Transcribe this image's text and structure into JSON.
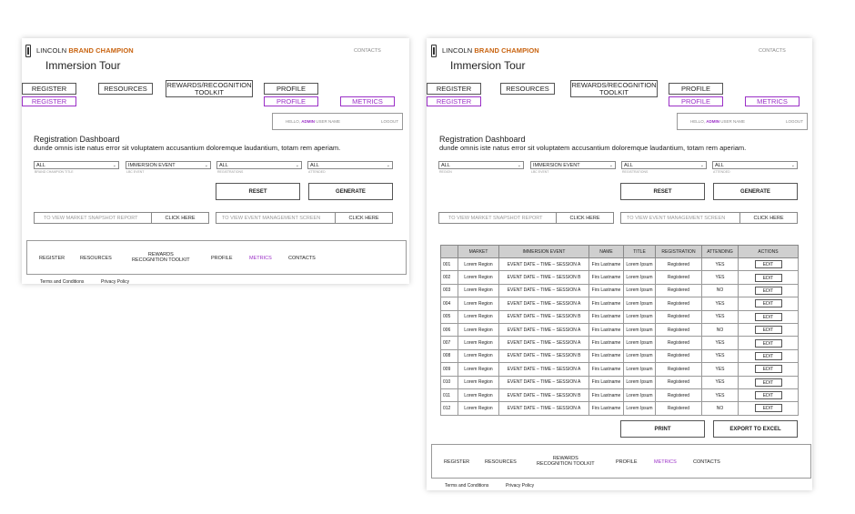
{
  "header": {
    "brand_prefix": "LINCOLN",
    "brand_name": "BRAND CHAMPION",
    "title": "Immersion Tour",
    "contacts_link": "CONTACTS"
  },
  "nav": {
    "register": "REGISTER",
    "resources": "RESOURCES",
    "rewards": "REWARDS/RECOGNITION TOOLKIT",
    "profile": "PROFILE",
    "sub_register": "REGISTER",
    "sub_profile": "PROFILE",
    "sub_metrics": "METRICS"
  },
  "user": {
    "hello": "HELLO,",
    "admin": "ADMIN",
    "user_name": "USER NAME",
    "logout": "LOGOUT"
  },
  "dashboard": {
    "title": "Registration Dashboard",
    "description": "dunde omnis iste natus error sit voluptatem accusantium doloremque laudantium, totam rem aperiam."
  },
  "filters": {
    "left": [
      {
        "value": "ALL",
        "label": "BRAND CHAMPION TITLE"
      },
      {
        "value": "IMMERSION EVENT",
        "label": "LBC EVENT"
      },
      {
        "value": "ALL",
        "label": "REGISTRATIONS"
      },
      {
        "value": "ALL",
        "label": "ATTENDED"
      }
    ],
    "right": [
      {
        "value": "ALL",
        "label": "REGION"
      },
      {
        "value": "IMMERSION EVENT",
        "label": "LBC EVENT"
      },
      {
        "value": "ALL",
        "label": "REGISTRATIONS"
      },
      {
        "value": "ALL",
        "label": "ATTENDED"
      }
    ],
    "chevron": "⌄"
  },
  "actions": {
    "reset": "RESET",
    "generate": "GENERATE",
    "print": "PRINT",
    "export": "EXPORT TO EXCEL"
  },
  "links": {
    "market_snapshot": "TO VIEW MARKET SNAPSHOT REPORT",
    "event_management": "TO VIEW EVENT MANAGEMENT SCREEN",
    "click_here": "CLICK HERE"
  },
  "footer": {
    "register": "REGISTER",
    "resources": "RESOURCES",
    "rewards_line1": "REWARDS",
    "rewards_line2": "RECOGNITION TOOLKIT",
    "profile": "PROFILE",
    "metrics": "METRICS",
    "contacts": "CONTACTS",
    "terms": "Terms and Conditions",
    "privacy": "Privacy Policy"
  },
  "table": {
    "columns": [
      "",
      "MARKET",
      "IMMERSION EVENT",
      "NAME",
      "TITLE",
      "REGISTRATION",
      "ATTENDING",
      "ACTIONS"
    ],
    "rows": [
      {
        "id": "001",
        "market": "Lorem Region",
        "event": "EVENT DATE – TIME – SESSION A",
        "name": "Firs Lastname",
        "title": "Lorem Ipsum",
        "registration": "Registered",
        "attending": "YES",
        "action": "EDIT"
      },
      {
        "id": "002",
        "market": "Lorem Region",
        "event": "EVENT DATE – TIME – SESSION B",
        "name": "Firs Lastname",
        "title": "Lorem Ipsum",
        "registration": "Registered",
        "attending": "YES",
        "action": "EDIT"
      },
      {
        "id": "003",
        "market": "Lorem Region",
        "event": "EVENT DATE – TIME – SESSION A",
        "name": "Firs Lastname",
        "title": "Lorem Ipsum",
        "registration": "Registered",
        "attending": "NO",
        "action": "EDIT"
      },
      {
        "id": "004",
        "market": "Lorem Region",
        "event": "EVENT DATE – TIME – SESSION A",
        "name": "Firs Lastname",
        "title": "Lorem Ipsum",
        "registration": "Registered",
        "attending": "YES",
        "action": "EDIT"
      },
      {
        "id": "005",
        "market": "Lorem Region",
        "event": "EVENT DATE – TIME – SESSION B",
        "name": "Firs Lastname",
        "title": "Lorem Ipsum",
        "registration": "Registered",
        "attending": "YES",
        "action": "EDIT"
      },
      {
        "id": "006",
        "market": "Lorem Region",
        "event": "EVENT DATE – TIME – SESSION A",
        "name": "Firs Lastname",
        "title": "Lorem Ipsum",
        "registration": "Registered",
        "attending": "NO",
        "action": "EDIT"
      },
      {
        "id": "007",
        "market": "Lorem Region",
        "event": "EVENT DATE – TIME – SESSION A",
        "name": "Firs Lastname",
        "title": "Lorem Ipsum",
        "registration": "Registered",
        "attending": "YES",
        "action": "EDIT"
      },
      {
        "id": "008",
        "market": "Lorem Region",
        "event": "EVENT DATE – TIME – SESSION B",
        "name": "Firs Lastname",
        "title": "Lorem Ipsum",
        "registration": "Registered",
        "attending": "YES",
        "action": "EDIT"
      },
      {
        "id": "009",
        "market": "Lorem Region",
        "event": "EVENT DATE – TIME – SESSION A",
        "name": "Firs Lastname",
        "title": "Lorem Ipsum",
        "registration": "Registered",
        "attending": "YES",
        "action": "EDIT"
      },
      {
        "id": "010",
        "market": "Lorem Region",
        "event": "EVENT DATE – TIME – SESSION A",
        "name": "Firs Lastname",
        "title": "Lorem Ipsum",
        "registration": "Registered",
        "attending": "YES",
        "action": "EDIT"
      },
      {
        "id": "011",
        "market": "Lorem Region",
        "event": "EVENT DATE – TIME – SESSION B",
        "name": "Firs Lastname",
        "title": "Lorem Ipsum",
        "registration": "Registered",
        "attending": "YES",
        "action": "EDIT"
      },
      {
        "id": "012",
        "market": "Lorem Region",
        "event": "EVENT DATE – TIME – SESSION A",
        "name": "Firs Lastname",
        "title": "Lorem Ipsum",
        "registration": "Registered",
        "attending": "NO",
        "action": "EDIT"
      }
    ]
  },
  "colors": {
    "brand_orange": "#c8620e",
    "accent_purple": "#9b30c7"
  }
}
